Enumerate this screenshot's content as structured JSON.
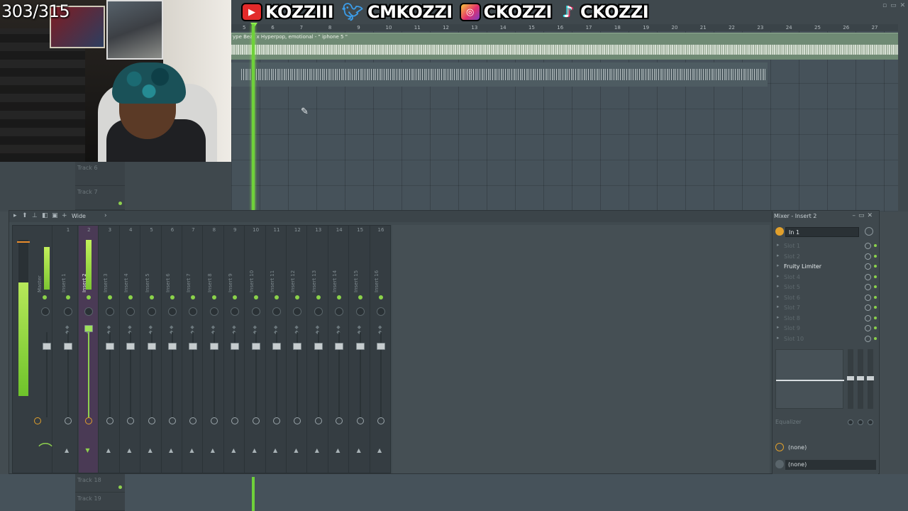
{
  "counter": "303/315",
  "social": {
    "youtube": "KOZZIII",
    "twitter": "CMKOZZI",
    "instagram": "CKOZZI",
    "tiktok": "CKOZZI"
  },
  "playlist": {
    "clip_label": "ype Beat x Hyperpop, emotional - \" iphone 5 \"",
    "ruler": [
      "5",
      "6",
      "7",
      "8",
      "9",
      "10",
      "11",
      "12",
      "13",
      "14",
      "15",
      "16",
      "17",
      "18",
      "19",
      "20",
      "21",
      "22",
      "23",
      "24",
      "25",
      "26",
      "27"
    ],
    "tracks": [
      {
        "label": "Track 6"
      },
      {
        "label": "Track 7"
      },
      {
        "label": "Track 18"
      },
      {
        "label": "Track 19"
      }
    ]
  },
  "mixer": {
    "preset": "Wide",
    "master_label": "Master",
    "strips": [
      {
        "num": "1",
        "name": "Insert 1"
      },
      {
        "num": "2",
        "name": "Insert 2"
      },
      {
        "num": "3",
        "name": "Insert 3"
      },
      {
        "num": "4",
        "name": "Insert 4"
      },
      {
        "num": "5",
        "name": "Insert 5"
      },
      {
        "num": "6",
        "name": "Insert 6"
      },
      {
        "num": "7",
        "name": "Insert 7"
      },
      {
        "num": "8",
        "name": "Insert 8"
      },
      {
        "num": "9",
        "name": "Insert 9"
      },
      {
        "num": "10",
        "name": "Insert 10"
      },
      {
        "num": "11",
        "name": "Insert 11"
      },
      {
        "num": "12",
        "name": "Insert 12"
      },
      {
        "num": "13",
        "name": "Insert 13"
      },
      {
        "num": "14",
        "name": "Insert 14"
      },
      {
        "num": "15",
        "name": "Insert 15"
      },
      {
        "num": "16",
        "name": "Insert 16"
      }
    ],
    "selected_insert": "Insert 2"
  },
  "insert_panel": {
    "title": "Mixer - Insert 2",
    "input": "In 1",
    "slots": [
      {
        "name": "Slot 1",
        "active": false
      },
      {
        "name": "Slot 2",
        "active": false
      },
      {
        "name": "Fruity Limiter",
        "active": true
      },
      {
        "name": "Slot 4",
        "active": false
      },
      {
        "name": "Slot 5",
        "active": false
      },
      {
        "name": "Slot 6",
        "active": false
      },
      {
        "name": "Slot 7",
        "active": false
      },
      {
        "name": "Slot 8",
        "active": false
      },
      {
        "name": "Slot 9",
        "active": false
      },
      {
        "name": "Slot 10",
        "active": false
      }
    ],
    "eq_label": "Equalizer",
    "send_1": "(none)",
    "send_2": "(none)"
  },
  "colors": {
    "accent_green": "#8ed04e",
    "playhead": "#6fd13a",
    "selected_strip": "#4a3a55"
  }
}
